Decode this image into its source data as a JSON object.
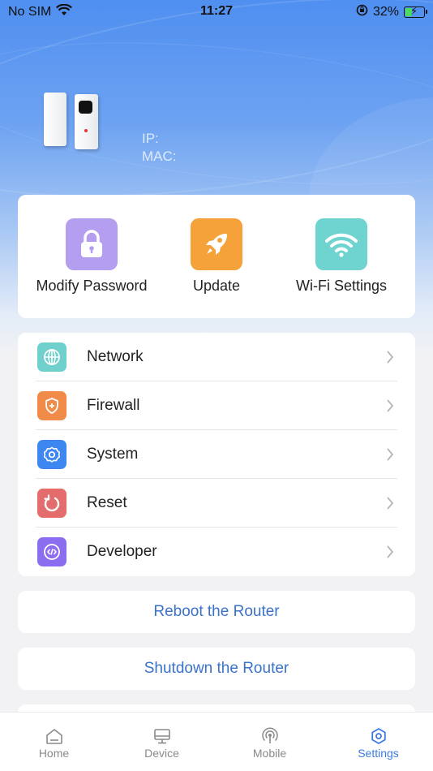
{
  "status_bar": {
    "carrier": "No SIM",
    "time": "11:27",
    "battery": "32%",
    "battery_level": 0.32
  },
  "device": {
    "ip_label": "IP:",
    "mac_label": "MAC:"
  },
  "quick_actions": [
    {
      "label": "Modify Password",
      "icon": "lock-icon",
      "color": "#b49ef0"
    },
    {
      "label": "Update",
      "icon": "rocket-icon",
      "color": "#f5a23a"
    },
    {
      "label": "Wi-Fi Settings",
      "icon": "wifi-icon",
      "color": "#6fd3cf"
    }
  ],
  "menu": [
    {
      "label": "Network",
      "icon": "globe-icon",
      "color": "#6fd0cc"
    },
    {
      "label": "Firewall",
      "icon": "shield-icon",
      "color": "#f08b4a"
    },
    {
      "label": "System",
      "icon": "gear-icon",
      "color": "#3e86f0"
    },
    {
      "label": "Reset",
      "icon": "reset-icon",
      "color": "#e56c6c"
    },
    {
      "label": "Developer",
      "icon": "code-icon",
      "color": "#8b6df0"
    }
  ],
  "actions": {
    "reboot": "Reboot the Router",
    "shutdown": "Shutdown the Router"
  },
  "tabs": [
    {
      "label": "Home",
      "icon": "home-icon"
    },
    {
      "label": "Device",
      "icon": "monitor-icon"
    },
    {
      "label": "Mobile",
      "icon": "signal-icon"
    },
    {
      "label": "Settings",
      "icon": "settings-icon",
      "active": true
    }
  ],
  "colors": {
    "accent": "#3d7be3",
    "action_text": "#3a72c9",
    "hero_top": "#4f8ff0"
  }
}
